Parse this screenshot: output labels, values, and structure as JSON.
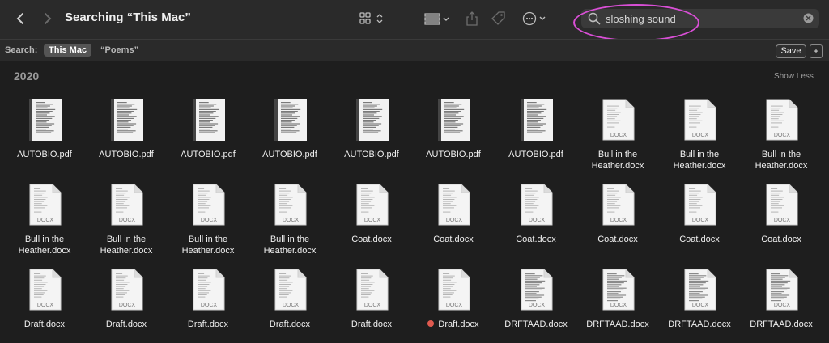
{
  "window": {
    "title": "Searching “This Mac”"
  },
  "toolbar": {
    "icons": [
      "chevron-left-icon",
      "chevron-right-icon",
      "icon-view-icon",
      "group-icon",
      "share-icon",
      "tag-icon",
      "more-icon"
    ]
  },
  "search": {
    "value": "sloshing sound",
    "highlight_color": "#d94fd6"
  },
  "scope": {
    "label": "Search:",
    "options": [
      "This Mac",
      "“Poems”"
    ],
    "selected": "This Mac",
    "save_label": "Save",
    "plus_label": "+"
  },
  "section": {
    "title": "2020",
    "show_less": "Show Less"
  },
  "files": [
    {
      "name": "AUTOBIO.pdf",
      "kind": "pdf"
    },
    {
      "name": "AUTOBIO.pdf",
      "kind": "pdf"
    },
    {
      "name": "AUTOBIO.pdf",
      "kind": "pdf"
    },
    {
      "name": "AUTOBIO.pdf",
      "kind": "pdf"
    },
    {
      "name": "AUTOBIO.pdf",
      "kind": "pdf"
    },
    {
      "name": "AUTOBIO.pdf",
      "kind": "pdf"
    },
    {
      "name": "AUTOBIO.pdf",
      "kind": "pdf"
    },
    {
      "name": "Bull in the\nHeather.docx",
      "kind": "docx"
    },
    {
      "name": "Bull in the\nHeather.docx",
      "kind": "docx"
    },
    {
      "name": "Bull in the\nHeather.docx",
      "kind": "docx"
    },
    {
      "name": "Bull in the\nHeather.docx",
      "kind": "docx"
    },
    {
      "name": "Bull in the\nHeather.docx",
      "kind": "docx"
    },
    {
      "name": "Bull in the\nHeather.docx",
      "kind": "docx"
    },
    {
      "name": "Bull in the\nHeather.docx",
      "kind": "docx"
    },
    {
      "name": "Coat.docx",
      "kind": "docx"
    },
    {
      "name": "Coat.docx",
      "kind": "docx"
    },
    {
      "name": "Coat.docx",
      "kind": "docx"
    },
    {
      "name": "Coat.docx",
      "kind": "docx"
    },
    {
      "name": "Coat.docx",
      "kind": "docx"
    },
    {
      "name": "Coat.docx",
      "kind": "docx"
    },
    {
      "name": "Draft.docx",
      "kind": "docx"
    },
    {
      "name": "Draft.docx",
      "kind": "docx"
    },
    {
      "name": "Draft.docx",
      "kind": "docx"
    },
    {
      "name": "Draft.docx",
      "kind": "docx"
    },
    {
      "name": "Draft.docx",
      "kind": "docx"
    },
    {
      "name": "Draft.docx",
      "kind": "docx",
      "tag": "#e05a4f"
    },
    {
      "name": "DRFTAAD.docx",
      "kind": "docx-dense"
    },
    {
      "name": "DRFTAAD.docx",
      "kind": "docx-dense"
    },
    {
      "name": "DRFTAAD.docx",
      "kind": "docx-dense"
    },
    {
      "name": "DRFTAAD.docx",
      "kind": "docx-dense"
    }
  ],
  "docx_badge": "DOCX"
}
